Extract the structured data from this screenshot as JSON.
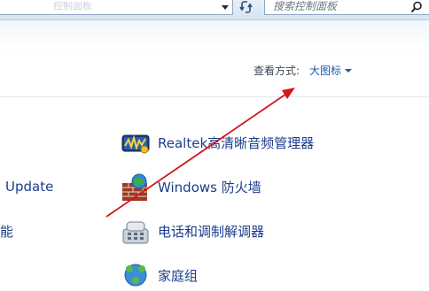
{
  "toolbar": {
    "address_text": "控制面板",
    "search_placeholder": "搜索控制面板"
  },
  "view": {
    "label": "查看方式:",
    "value": "大图标"
  },
  "items": [
    {
      "label": "Realtek高清晰音频管理器",
      "icon": "realtek-audio-icon"
    },
    {
      "label": "Windows 防火墙",
      "icon": "firewall-icon"
    },
    {
      "label": "电话和调制解调器",
      "icon": "phone-modem-icon"
    },
    {
      "label": "家庭组",
      "icon": "homegroup-icon"
    }
  ],
  "left_column": [
    {
      "label": "Update"
    },
    {
      "label": "能"
    }
  ],
  "colors": {
    "link": "#1b3d8f",
    "annotation_arrow": "#d0161b"
  }
}
